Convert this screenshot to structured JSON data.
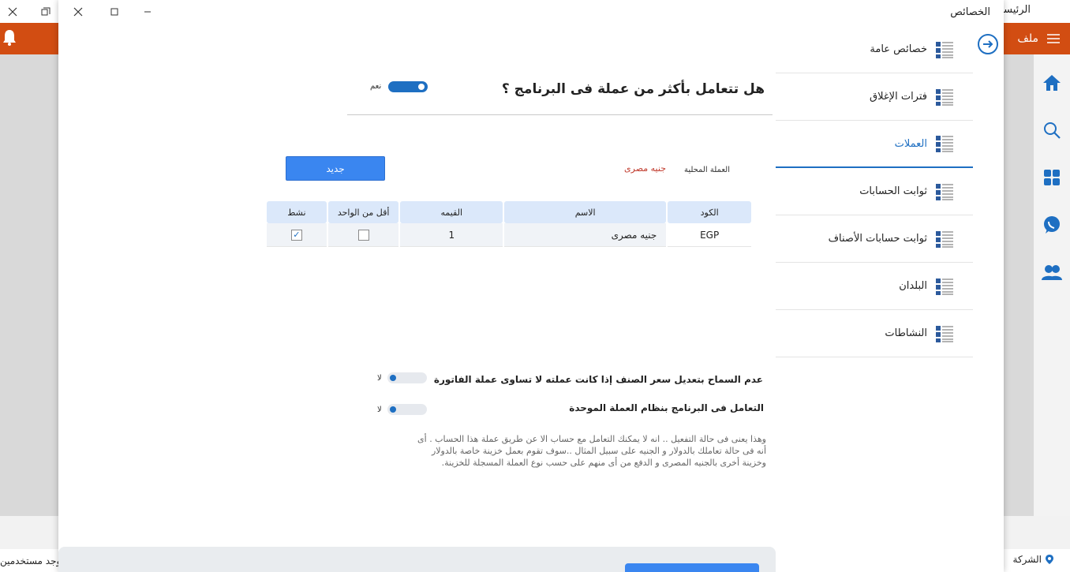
{
  "app": {
    "tabs": [
      "الرئيسية",
      "الخصائص"
    ],
    "menu_file": "ملف",
    "status_left": "يوجد مستخدمين",
    "status_company": "الشركة"
  },
  "window": {
    "title": "الخصائص"
  },
  "nav": {
    "items": [
      {
        "label": "خصائص عامة"
      },
      {
        "label": "فترات الإغلاق"
      },
      {
        "label": "العملات"
      },
      {
        "label": "ثوابت الحسابات"
      },
      {
        "label": "ثوابت حسابات الأصناف"
      },
      {
        "label": "البلدان"
      },
      {
        "label": "النشاطات"
      }
    ],
    "active_index": 2
  },
  "currencies": {
    "question": "هل تتعامل بأكثر من عملة فى البرنامج ؟",
    "multi_currency_toggle_label": "نعم",
    "local_currency_label": "العملة المحلية",
    "local_currency_value": "جنيه مصرى",
    "new_button": "جديد",
    "table": {
      "headers": {
        "code": "الكود",
        "name": "الاسم",
        "value": "القيمه",
        "less_than_one": "أقل من الواحد",
        "active": "نشط"
      },
      "rows": [
        {
          "code": "EGP",
          "name": "جنيه مصرى",
          "value": "1",
          "less_than_one": false,
          "active": true
        }
      ]
    },
    "option1_text": "عدم السماح بتعديل سعر الصنف إذا كانت عملته لا تساوى عملة الفاتورة",
    "option1_toggle_label": "لا",
    "option2_text": "التعامل فى البرنامج بنظام العملة الموحدة",
    "option2_toggle_label": "لا",
    "note_lines": [
      "وهذا يعنى فى حالة التفعيل .. انه لا يمكنك التعامل مع حساب الا عن طريق عملة هذا الحساب . أى",
      "أنه فى حالة تعاملك بالدولار و الجنيه على سبيل المثال ..سوف تقوم بعمل خزينة خاصة بالدولار",
      "وخزينة أخرى بالجنيه المصرى و الدفع من أى منهم على حسب نوع العملة المسجلة للخزينة."
    ]
  },
  "colors": {
    "accent": "#1e6fc2",
    "brand_orange": "#d24d12",
    "button_blue": "#3a86f0",
    "local_currency_red": "#c0392b"
  }
}
